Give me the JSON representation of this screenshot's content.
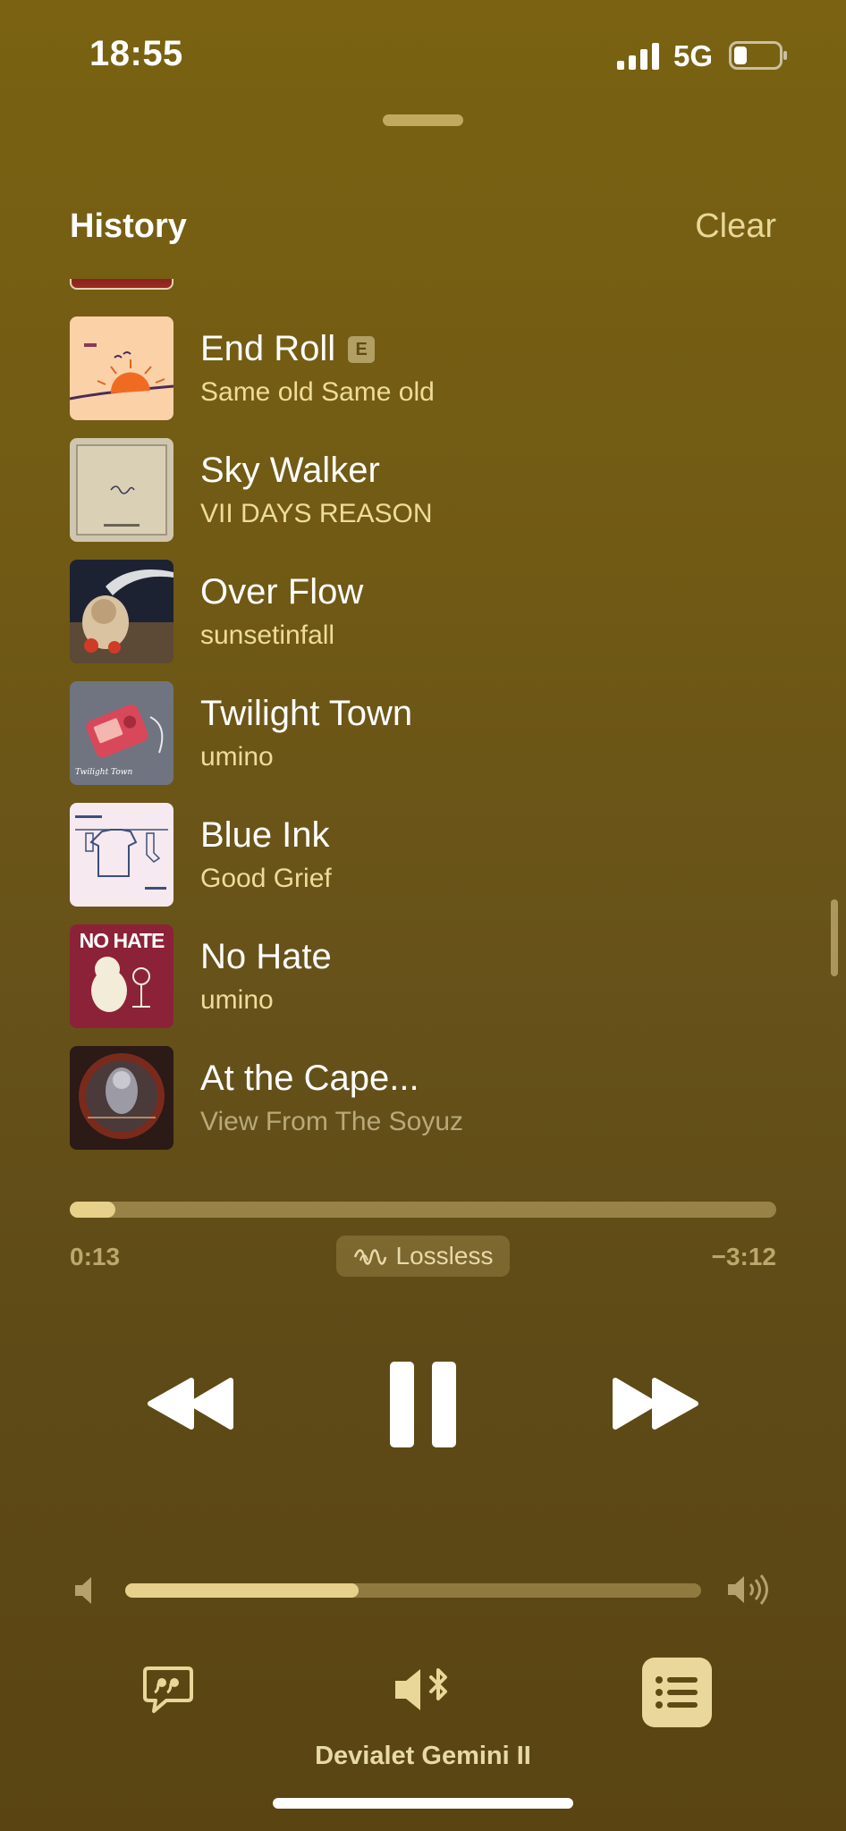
{
  "status_bar": {
    "time": "18:55",
    "network": "5G",
    "battery_level_fraction": 0.3
  },
  "header": {
    "title": "History",
    "clear_label": "Clear"
  },
  "history": [
    {
      "title": "End Roll",
      "artist": "Same old Same old",
      "explicit": true,
      "explicit_label": "E",
      "art_text": ""
    },
    {
      "title": "Sky Walker",
      "artist": "VII DAYS REASON",
      "explicit": false,
      "art_text": ""
    },
    {
      "title": "Over Flow",
      "artist": "sunsetinfall",
      "explicit": false,
      "art_text": ""
    },
    {
      "title": "Twilight Town",
      "artist": "umino",
      "explicit": false,
      "art_text": "Twilight Town"
    },
    {
      "title": "Blue Ink",
      "artist": "Good Grief",
      "explicit": false,
      "art_text": ""
    },
    {
      "title": "No Hate",
      "artist": "umino",
      "explicit": false,
      "art_text": "NO HATE"
    },
    {
      "title": "At the Cape...",
      "artist": "View From The Soyuz",
      "explicit": false,
      "art_text": ""
    }
  ],
  "playback": {
    "elapsed": "0:13",
    "remaining": "−3:12",
    "progress_fraction": 0.065,
    "quality_label": "Lossless",
    "state": "playing"
  },
  "volume": {
    "level_fraction": 0.405
  },
  "footer": {
    "device_name": "Devialet Gemini II"
  },
  "icons": {
    "signal": "signal-bars-icon",
    "battery": "battery-icon",
    "rewind": "rewind-icon",
    "pause": "pause-icon",
    "forward": "fast-forward-icon",
    "volume_low": "speaker-low-icon",
    "volume_high": "speaker-high-icon",
    "lyrics": "lyrics-quote-icon",
    "airplay": "speaker-bluetooth-icon",
    "queue": "queue-list-icon",
    "lossless": "lossless-wave-icon"
  },
  "colors": {
    "background": "#715a14",
    "accent": "#e8d799",
    "artist_text": "#eedc9a"
  }
}
